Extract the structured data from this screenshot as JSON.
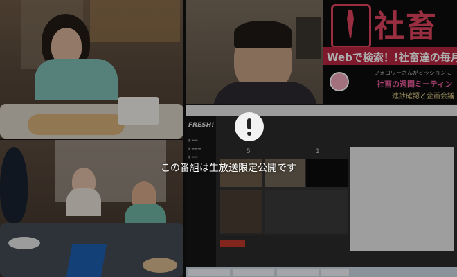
{
  "overlay": {
    "icon": "exclamation-icon",
    "message": "この番組は生放送限定公開です"
  },
  "banner": {
    "title": "社畜",
    "web_line": "Webで検索！!社畜達の毎月",
    "follower_line": "フォロワーさんがミッションに",
    "meeting_line": "社畜の週間ミーティン",
    "progress_line": "進捗確認と企画会議"
  },
  "app": {
    "brand": "FRESH!",
    "viewer_count_1": "5",
    "viewer_count_2": "1"
  }
}
